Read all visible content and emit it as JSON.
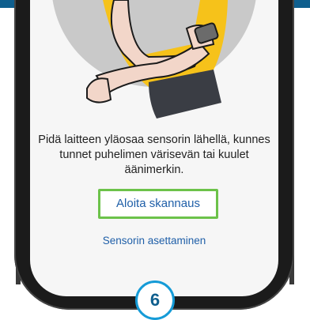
{
  "screen": {
    "instruction": "Pidä laitteen yläosaa sensorin lähellä, kunnes tunnet puhelimen värisevän tai kuulet äänimerkin.",
    "start_scan_button": "Aloita skannaus",
    "sensor_setup_link": "Sensorin asettaminen"
  },
  "step_number": "6",
  "illustration": {
    "icon": "person-scanning-sensor-illustration"
  },
  "colors": {
    "top_bar": "#0f5f8e",
    "button_border": "#6cc24a",
    "link_text": "#1f5fa8",
    "badge_border": "#159bd7"
  }
}
